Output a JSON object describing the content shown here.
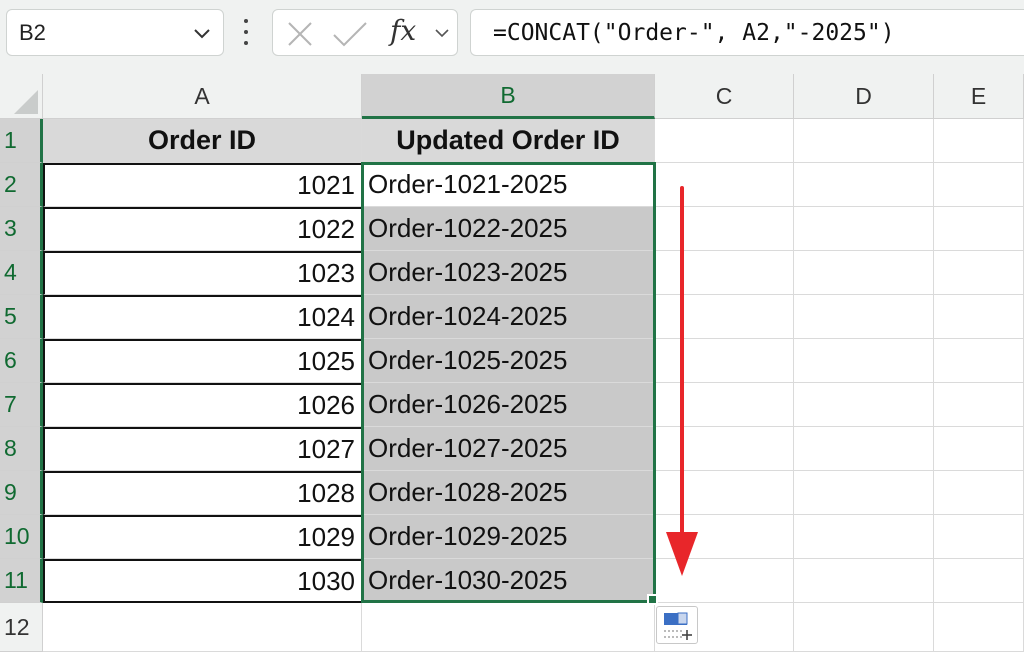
{
  "formula_bar": {
    "name_box": "B2",
    "formula": "=CONCAT(\"Order-\", A2,\"-2025\")",
    "fx_label": "fx"
  },
  "columns": [
    "A",
    "B",
    "C",
    "D",
    "E"
  ],
  "rows": [
    "1",
    "2",
    "3",
    "4",
    "5",
    "6",
    "7",
    "8",
    "9",
    "10",
    "11",
    "12"
  ],
  "sheet": {
    "header": {
      "a": "Order ID",
      "b": "Updated Order ID"
    },
    "data": [
      {
        "a": "1021",
        "b": "Order-1021-2025"
      },
      {
        "a": "1022",
        "b": "Order-1022-2025"
      },
      {
        "a": "1023",
        "b": "Order-1023-2025"
      },
      {
        "a": "1024",
        "b": "Order-1024-2025"
      },
      {
        "a": "1025",
        "b": "Order-1025-2025"
      },
      {
        "a": "1026",
        "b": "Order-1026-2025"
      },
      {
        "a": "1027",
        "b": "Order-1027-2025"
      },
      {
        "a": "1028",
        "b": "Order-1028-2025"
      },
      {
        "a": "1029",
        "b": "Order-1029-2025"
      },
      {
        "a": "1030",
        "b": "Order-1030-2025"
      }
    ]
  },
  "selection": {
    "active_cell": "B2",
    "range": "B1:B11"
  },
  "icons": {
    "name_box_dropdown": "chevron-down-icon",
    "more": "more-options-icon",
    "cancel": "cancel-x-icon",
    "enter": "checkmark-icon",
    "autofill_options": "auto-fill-options-icon",
    "annotation": "red-down-arrow-icon"
  },
  "colors": {
    "selection": "#217346",
    "annotation_arrow": "#e8262a",
    "fill_gray": "#c9c9c9"
  }
}
